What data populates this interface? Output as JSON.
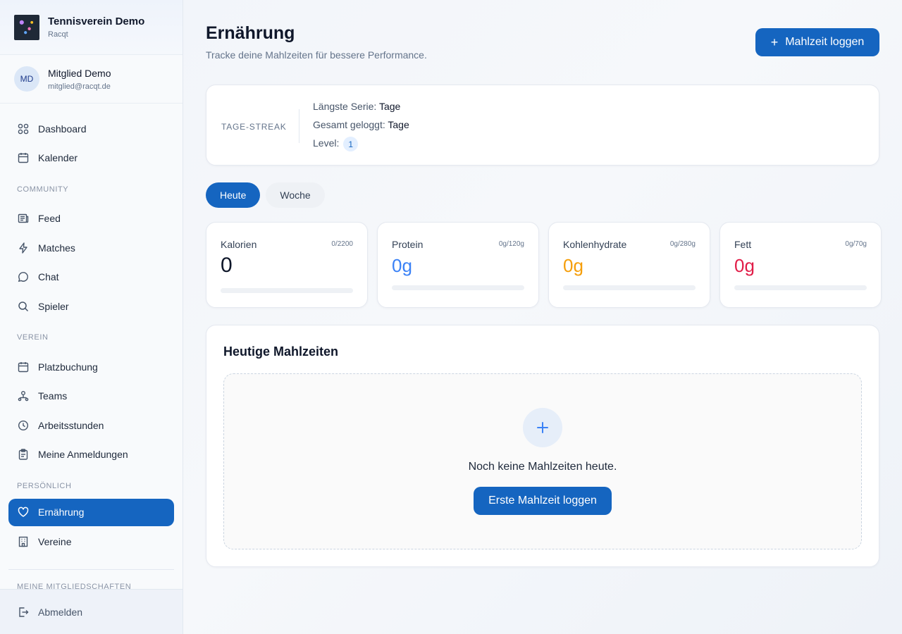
{
  "brand": {
    "name": "Tennisverein Demo",
    "sub": "Racqt"
  },
  "user": {
    "initials": "MD",
    "name": "Mitglied Demo",
    "email": "mitglied@racqt.de"
  },
  "nav": {
    "top": [
      {
        "label": "Dashboard",
        "icon": "grid-icon"
      },
      {
        "label": "Kalender",
        "icon": "calendar-icon"
      }
    ],
    "community_label": "COMMUNITY",
    "community": [
      {
        "label": "Feed",
        "icon": "newspaper-icon"
      },
      {
        "label": "Matches",
        "icon": "lightning-icon"
      },
      {
        "label": "Chat",
        "icon": "chat-icon"
      },
      {
        "label": "Spieler",
        "icon": "search-icon"
      }
    ],
    "verein_label": "VEREIN",
    "verein": [
      {
        "label": "Platzbuchung",
        "icon": "calendar-icon"
      },
      {
        "label": "Teams",
        "icon": "teams-icon"
      },
      {
        "label": "Arbeitsstunden",
        "icon": "clock-icon"
      },
      {
        "label": "Meine Anmeldungen",
        "icon": "clipboard-icon"
      }
    ],
    "personal_label": "PERSÖNLICH",
    "personal": [
      {
        "label": "Ernährung",
        "icon": "heart-icon",
        "active": true
      },
      {
        "label": "Vereine",
        "icon": "building-icon"
      }
    ],
    "memberships_label": "MEINE MITGLIEDSCHAFTEN",
    "logout": "Abmelden"
  },
  "header": {
    "title": "Ernährung",
    "subtitle": "Tracke deine Mahlzeiten für bessere Performance.",
    "log_button": "Mahlzeit loggen"
  },
  "streak": {
    "label": "TAGE-STREAK",
    "longest_label": "Längste Serie:",
    "longest_value": "Tage",
    "total_label": "Gesamt geloggt:",
    "total_value": "Tage",
    "level_label": "Level:",
    "level_value": "1"
  },
  "tabs": [
    {
      "label": "Heute",
      "active": true
    },
    {
      "label": "Woche",
      "active": false
    }
  ],
  "stats": [
    {
      "label": "Kalorien",
      "goal": "0/2200",
      "value": "0",
      "color": "#0f172a",
      "progress": 0
    },
    {
      "label": "Protein",
      "goal": "0g/120g",
      "value": "0g",
      "color": "#3b82f6",
      "progress": 0
    },
    {
      "label": "Kohlenhydrate",
      "goal": "0g/280g",
      "value": "0g",
      "color": "#f59e0b",
      "progress": 0
    },
    {
      "label": "Fett",
      "goal": "0g/70g",
      "value": "0g",
      "color": "#e11d48",
      "progress": 0
    }
  ],
  "meals": {
    "title": "Heutige Mahlzeiten",
    "empty_text": "Noch keine Mahlzeiten heute.",
    "empty_button": "Erste Mahlzeit loggen"
  },
  "colors": {
    "primary": "#1565c0"
  }
}
